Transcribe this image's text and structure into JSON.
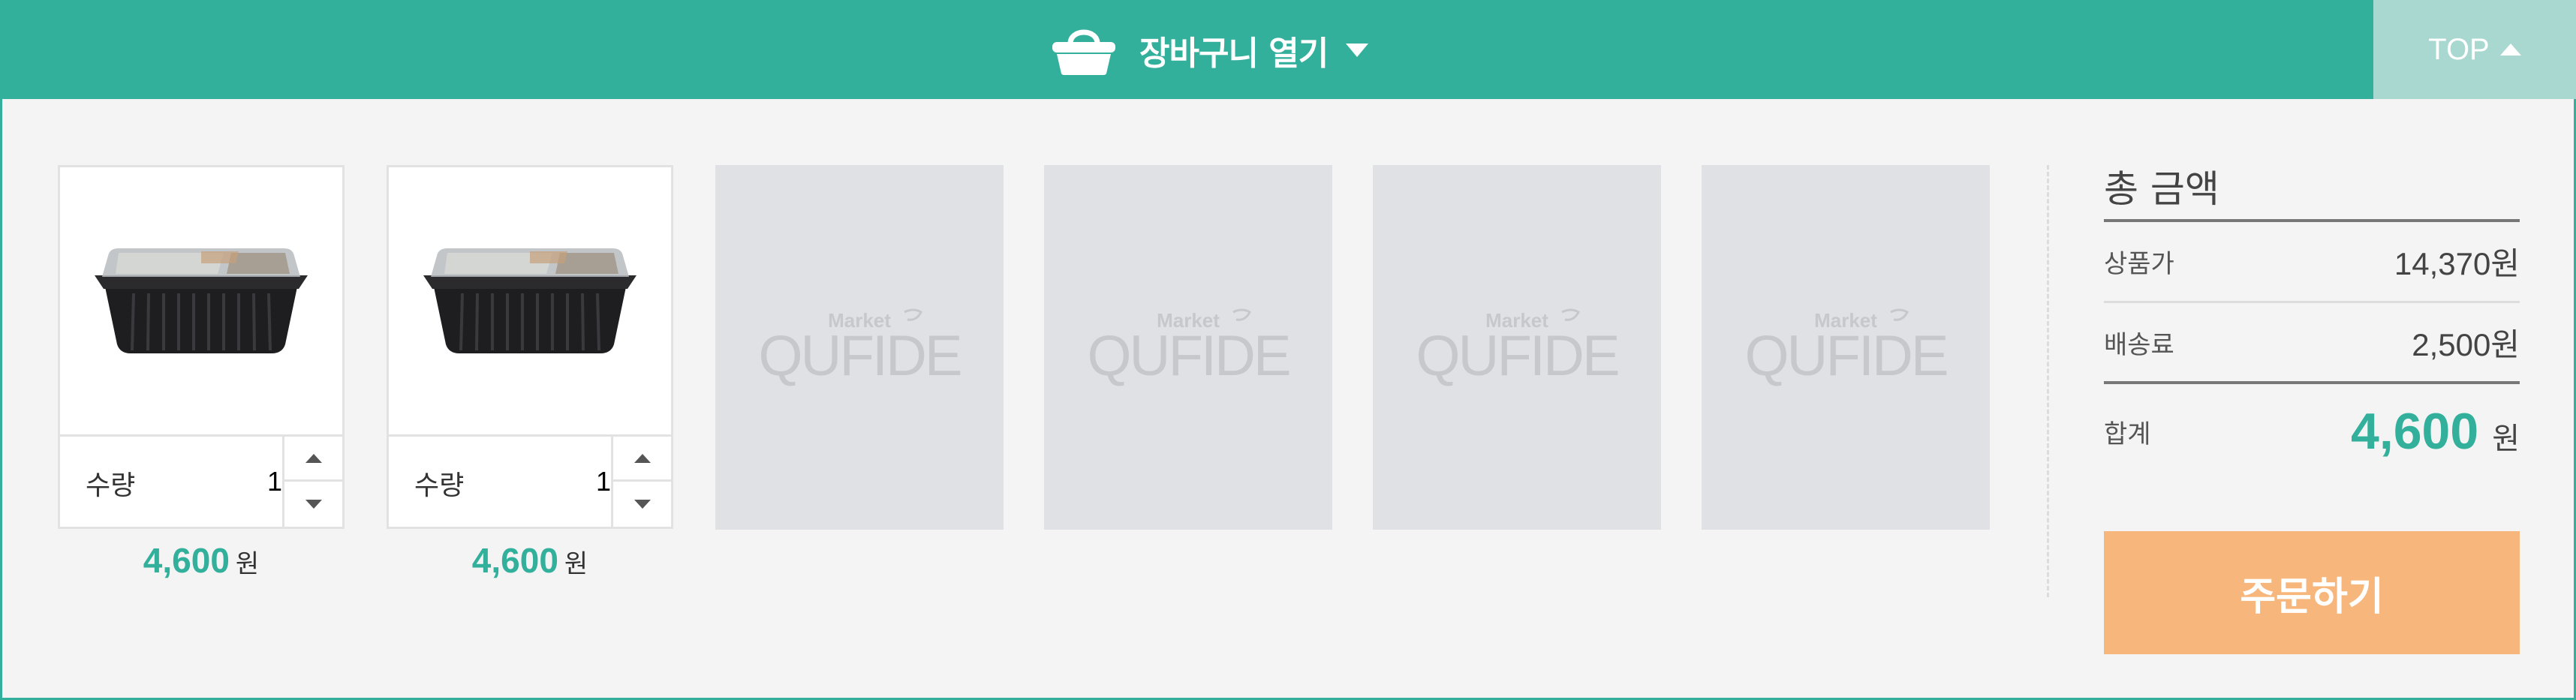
{
  "header": {
    "toggle_label": "장바구니 열기",
    "basket_icon": "basket-icon",
    "toggle_caret_icon": "caret-down-icon",
    "top_label": "TOP",
    "top_caret_icon": "caret-up-icon"
  },
  "colors": {
    "accent": "#33b09c",
    "top_button": "#a8d8d0",
    "order_button": "#f7b77c",
    "empty_slot": "#dfe1e5",
    "panel_bg": "#f4f4f4"
  },
  "cart": {
    "items": [
      {
        "image": "meal-container-image",
        "qty_label": "수량",
        "qty_value": "1",
        "price": "4,600",
        "currency": "원"
      },
      {
        "image": "meal-container-image",
        "qty_label": "수량",
        "qty_value": "1",
        "price": "4,600",
        "currency": "원"
      }
    ],
    "empty_slots": [
      {
        "logo_small": "Market",
        "logo_text": "QUFIDE"
      },
      {
        "logo_small": "Market",
        "logo_text": "QUFIDE"
      },
      {
        "logo_small": "Market",
        "logo_text": "QUFIDE"
      },
      {
        "logo_small": "Market",
        "logo_text": "QUFIDE"
      }
    ]
  },
  "summary": {
    "title": "총 금액",
    "product_label": "상품가",
    "product_value": "14,370원",
    "shipping_label": "배송료",
    "shipping_value": "2,500원",
    "total_label": "합계",
    "total_value": "4,600",
    "total_unit": "원",
    "order_button": "주문하기"
  }
}
